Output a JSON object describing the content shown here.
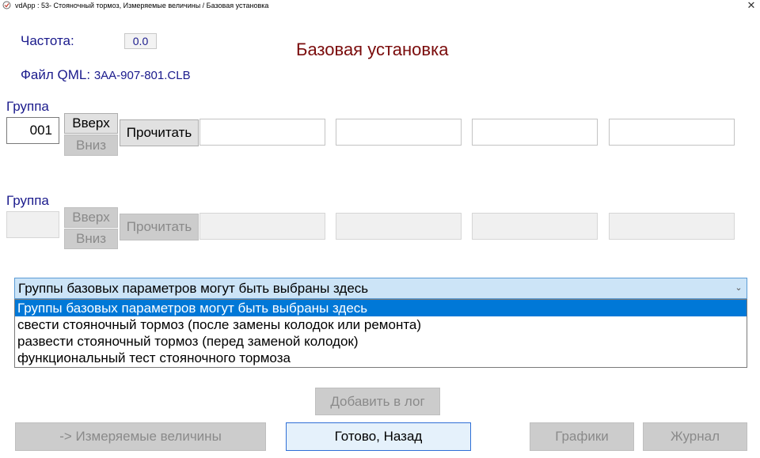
{
  "window": {
    "title": "vdApp : 53- Стояночный тормоз,  Измеряемые величины / Базовая установка",
    "close_glyph": "✕"
  },
  "header": {
    "frequency_label": "Частота:",
    "frequency_value": "0.0",
    "qml_label": "Файл QML:",
    "qml_file": "3AA-907-801.CLB",
    "heading": "Базовая установка"
  },
  "group1": {
    "label": "Группа",
    "number": "001",
    "up_label": "Вверх",
    "down_label": "Вниз",
    "read_label": "Прочитать",
    "fields": [
      "",
      "",
      "",
      ""
    ]
  },
  "group2": {
    "label": "Группа",
    "number": "",
    "up_label": "Вверх",
    "down_label": "Вниз",
    "read_label": "Прочитать",
    "fields": [
      "",
      "",
      "",
      ""
    ]
  },
  "selector": {
    "selected": "Группы базовых параметров могут быть выбраны здесь",
    "options": [
      "Группы базовых параметров могут быть выбраны здесь",
      "свести стояночный тормоз (после замены колодок или ремонта)",
      "развести стояночный тормоз (перед заменой колодок)",
      "функциональный тест стояночного тормоза"
    ],
    "highlighted_index": 0
  },
  "footer": {
    "add_to_log_label": "Добавить в лог",
    "measured_values_label": "-> Измеряемые величины",
    "done_back_label": "Готово, Назад",
    "graphs_label": "Графики",
    "journal_label": "Журнал"
  },
  "colors": {
    "heading": "#7a0b0b",
    "label_blue": "#1a1a8c",
    "selection": "#0078d7"
  }
}
